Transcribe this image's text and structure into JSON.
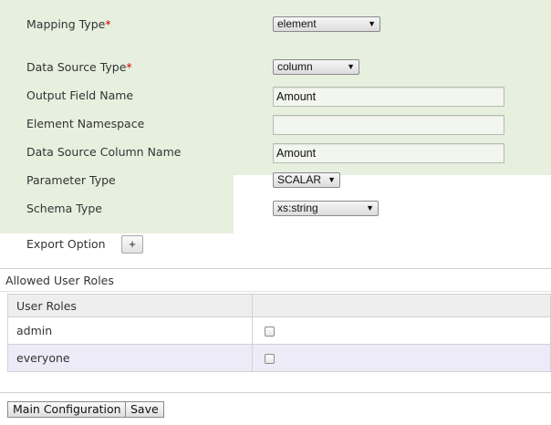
{
  "form": {
    "mapping_type_label": "Mapping Type",
    "required_mark": "*",
    "mapping_type_value": "element",
    "data_source_type_label": "Data Source Type",
    "data_source_type_value": "column",
    "output_field_name_label": "Output Field Name",
    "output_field_name_value": "Amount",
    "element_namespace_label": "Element Namespace",
    "element_namespace_value": "",
    "data_source_column_label": "Data Source Column Name",
    "data_source_column_value": "Amount",
    "parameter_type_label": "Parameter Type",
    "parameter_type_value": "SCALAR",
    "schema_type_label": "Schema Type",
    "schema_type_value": "xs:string",
    "export_option_label": "Export Option",
    "export_add_label": "+",
    "dropdown_arrow": "▼"
  },
  "roles": {
    "section_title": "Allowed User Roles",
    "column_header": "User Roles",
    "rows": [
      {
        "name": "admin",
        "checked": false
      },
      {
        "name": "everyone",
        "checked": false
      }
    ]
  },
  "footer": {
    "main_config_label": "Main Configuration",
    "save_label": "Save"
  }
}
